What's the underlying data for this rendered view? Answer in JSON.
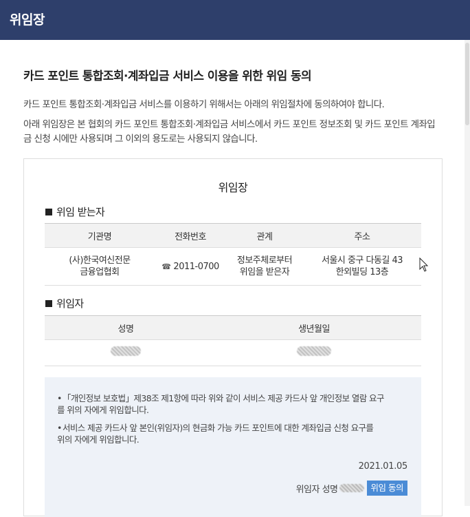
{
  "header": {
    "title": "위임장"
  },
  "section_title": "카드 포인트 통합조회·계좌입금 서비스 이용을 위한 위임 동의",
  "intro": [
    "카드 포인트 통합조회·계좌입금 서비스를 이용하기 위해서는 아래의 위임절차에 동의하여야 합니다.",
    "아래 위임장은 본 협회의 카드 포인트 통합조회·계좌입금 서비스에서 카드 포인트 정보조회 및 카드 포인트 계좌입금 신청 시에만 사용되며 그 이외의 용도로는 사용되지 않습니다."
  ],
  "document": {
    "title": "위임장",
    "recipient": {
      "heading": "위임 받는자",
      "columns": [
        "기관명",
        "전화번호",
        "관계",
        "주소"
      ],
      "row": {
        "org_line1": "(사)한국여신전문",
        "org_line2": "금융업협회",
        "phone": "2011-0700",
        "phone_icon": "phone-icon",
        "relation_line1": "정보주체로부터",
        "relation_line2": "위임을 받은자",
        "address_line1": "서울시 중구 다동길 43",
        "address_line2": "한외빌딩 13층"
      }
    },
    "delegator": {
      "heading": "위임자",
      "columns": [
        "성명",
        "생년월일"
      ]
    },
    "notice": {
      "bullets": [
        {
          "line1": "「개인정보 보호법」제38조 제1항에 따라 위와 같이 서비스 제공 카드사 앞 개인정보 열람 요구",
          "line2": "를 위의 자에게 위임합니다."
        },
        {
          "line1": "서비스 제공 카드사 앞 본인(위임자)의 현금화 가능 카드 포인트에 대한 계좌입금 신청 요구를",
          "line2": "위의 자에게 위임합니다."
        }
      ],
      "date": "2021.01.05",
      "signer_label": "위임자 성명",
      "agree_button": "위임 동의"
    }
  },
  "colors": {
    "header_bg": "#2e3f6b",
    "notice_bg": "#eef2f8",
    "button_bg": "#4a8bd6"
  }
}
